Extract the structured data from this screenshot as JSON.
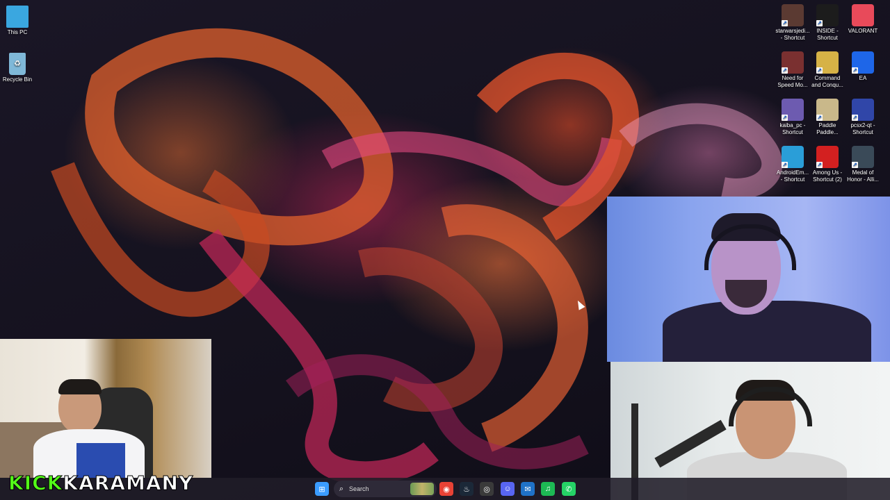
{
  "desktop": {
    "left_icons": [
      {
        "label": "This PC",
        "icon": "monitor-icon",
        "color": "#3aa7e0"
      },
      {
        "label": "Recycle Bin",
        "icon": "recycle-bin-icon",
        "color": "#7fb8d8"
      }
    ],
    "right_icons": [
      {
        "label1": "starwarsjedi...",
        "label2": "- Shortcut",
        "icon": "star-wars-jedi-icon",
        "color": "#5b3a32"
      },
      {
        "label1": "INSIDE -",
        "label2": "Shortcut",
        "icon": "inside-game-icon",
        "color": "#1c1c1c"
      },
      {
        "label1": "VALORANT",
        "label2": "",
        "icon": "valorant-icon",
        "color": "#e84a5a"
      },
      {
        "label1": "Need for",
        "label2": "Speed Mo...",
        "icon": "need-for-speed-icon",
        "color": "#7a3030"
      },
      {
        "label1": "Command",
        "label2": "and Conqu...",
        "icon": "command-and-conquer-icon",
        "color": "#d6b246"
      },
      {
        "label1": "EA",
        "label2": "",
        "icon": "ea-icon",
        "color": "#1e66e8"
      },
      {
        "label1": "kaiba_pc -",
        "label2": "Shortcut",
        "icon": "kaiba-icon",
        "color": "#6d5bb0"
      },
      {
        "label1": "Paddle",
        "label2": "Paddle...",
        "icon": "paddle-icon",
        "color": "#c9b88a"
      },
      {
        "label1": "pcsx2-qt -",
        "label2": "Shortcut",
        "icon": "pcsx2-icon",
        "color": "#3046a8"
      },
      {
        "label1": "AndroidEm...",
        "label2": "- Shortcut",
        "icon": "android-emulator-icon",
        "color": "#2a9ed8"
      },
      {
        "label1": "Among Us -",
        "label2": "Shortcut (2)",
        "icon": "among-us-icon",
        "color": "#d32020"
      },
      {
        "label1": "Medal of",
        "label2": "Honor - Alli...",
        "icon": "medal-of-honor-icon",
        "color": "#3a4a58"
      }
    ]
  },
  "taskbar": {
    "search_label": "Search",
    "items": [
      {
        "icon": "windows-start-icon",
        "color": "#3b9cff",
        "glyph": "⊞"
      },
      {
        "icon": "chrome-icon",
        "color": "#e94235",
        "glyph": "◉"
      },
      {
        "icon": "steam-icon",
        "color": "#1b2838",
        "glyph": "♨"
      },
      {
        "icon": "obs-icon",
        "color": "#3a3a3a",
        "glyph": "◎"
      },
      {
        "icon": "discord-icon",
        "color": "#5865f2",
        "glyph": "☺"
      },
      {
        "icon": "mail-icon",
        "color": "#1f72c8",
        "glyph": "✉"
      },
      {
        "icon": "spotify-icon",
        "color": "#1db954",
        "glyph": "♫"
      },
      {
        "icon": "whatsapp-icon",
        "color": "#25d366",
        "glyph": "✆"
      }
    ]
  },
  "overlay": {
    "kick_word": "KICK",
    "channel_name": "KARAMANY",
    "kick_color": "#53fc18"
  },
  "webcams": [
    {
      "name": "streamer-left"
    },
    {
      "name": "guest-top-right"
    },
    {
      "name": "guest-bottom-right"
    }
  ]
}
